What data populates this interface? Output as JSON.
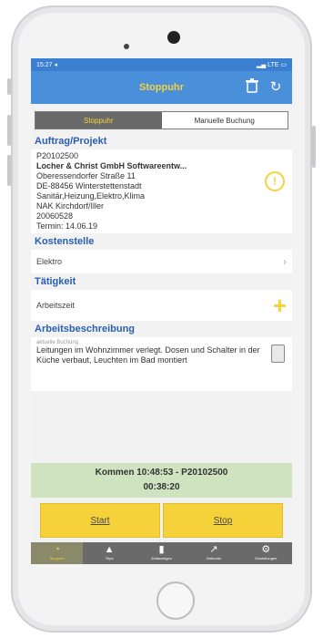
{
  "status_bar": {
    "time": "15:27 ◂",
    "right": "▂▄ LTE ▭"
  },
  "nav": {
    "title": "Stoppuhr",
    "trash_icon": "trash-icon",
    "refresh_icon": "refresh-icon"
  },
  "segment": {
    "tabs": [
      "Stoppuhr",
      "Manuelle Buchung"
    ],
    "active": 0
  },
  "auftrag": {
    "heading": "Auftrag/Projekt",
    "lines": [
      "P20102500",
      "Locher & Christ GmbH Softwareentw...",
      "Oberessendorfer Straße 11",
      "DE-88456 Winterstettenstadt",
      "Sanitär,Heizung,Elektro,Klima",
      "NAK Kirchdorf/Iller",
      "20060528",
      "Termin: 14.06.19"
    ],
    "info_icon": "info-icon"
  },
  "kostenstelle": {
    "heading": "Kostenstelle",
    "value": "Elektro"
  },
  "taetigkeit": {
    "heading": "Tätigkeit",
    "value": "Arbeitszeit"
  },
  "arbeitsbeschreibung": {
    "heading": "Arbeitsbeschreibung",
    "label": "aktuelle Buchung",
    "text": "Leitungen im Wohnzimmer verlegt. Dosen und Schalter in der Küche verbaut, Leuchten im Bad montiert"
  },
  "banner": {
    "line1": "Kommen 10:48:53 - P20102500",
    "line2": "00:38:20"
  },
  "buttons": {
    "start": "Start",
    "stop": "Stop"
  },
  "tabbar": [
    {
      "label": "Stoppuhr",
      "icon": "stopwatch-icon"
    },
    {
      "label": "Trips",
      "icon": "trips-icon"
    },
    {
      "label": "Zeitanzeigen",
      "icon": "clipboard-icon"
    },
    {
      "label": "Zeitkonto",
      "icon": "timer-icon"
    },
    {
      "label": "Einstellungen",
      "icon": "gear-icon"
    }
  ],
  "colors": {
    "accent": "#f6d23a",
    "nav": "#4a8fd9",
    "heading": "#2a5fb0",
    "banner": "#cfe3c0",
    "tabbar": "#6a6a6a"
  }
}
